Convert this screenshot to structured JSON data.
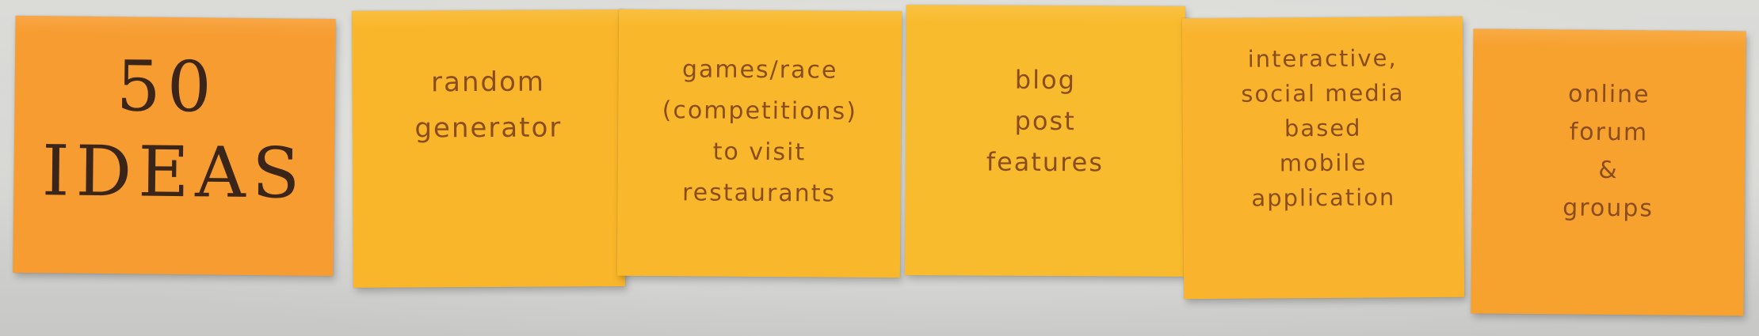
{
  "notes": [
    {
      "lines": [
        "50",
        "IDEAS"
      ],
      "color": "#f79c30"
    },
    {
      "lines": [
        "random",
        "generator"
      ],
      "color": "#f9b62a"
    },
    {
      "lines": [
        "games/race",
        "(competitions)",
        "to visit",
        "restaurants"
      ],
      "color": "#f9b82b"
    },
    {
      "lines": [
        "blog",
        "post",
        "features"
      ],
      "color": "#f9bb2e"
    },
    {
      "lines": [
        "interactive,",
        "social media",
        "based",
        "mobile",
        "application"
      ],
      "color": "#f9b32c"
    },
    {
      "lines": [
        "online",
        "forum",
        "&",
        "groups"
      ],
      "color": "#f7a12f"
    }
  ]
}
